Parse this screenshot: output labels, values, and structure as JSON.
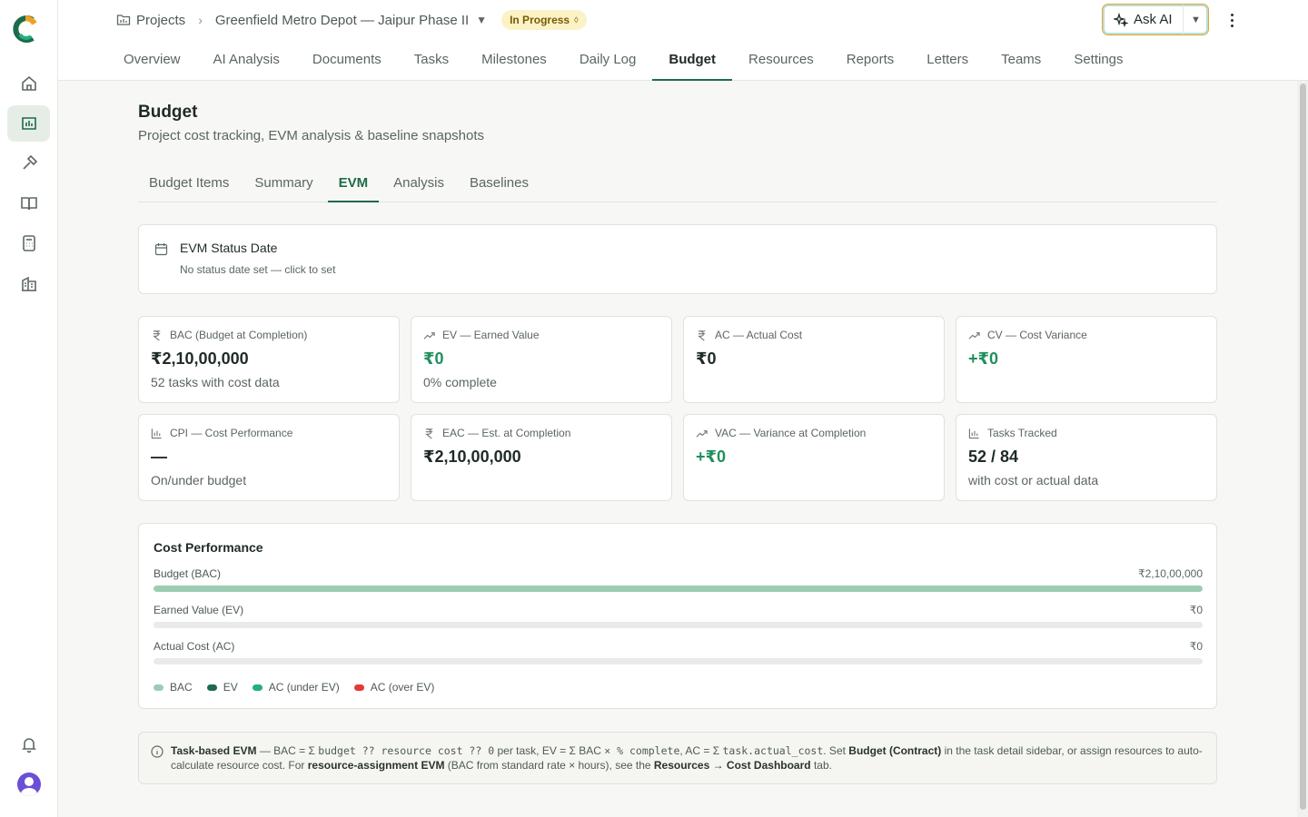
{
  "breadcrumb": {
    "projects": "Projects",
    "separator": "›",
    "project": "Greenfield Metro Depot — Jaipur Phase II",
    "status": "In Progress"
  },
  "header": {
    "ask_ai": "Ask AI",
    "tabs": [
      "Overview",
      "AI Analysis",
      "Documents",
      "Tasks",
      "Milestones",
      "Daily Log",
      "Budget",
      "Resources",
      "Reports",
      "Letters",
      "Teams",
      "Settings"
    ],
    "active_tab": "Budget"
  },
  "page": {
    "title": "Budget",
    "subtitle": "Project cost tracking, EVM analysis & baseline snapshots",
    "subtabs": [
      "Budget Items",
      "Summary",
      "EVM",
      "Analysis",
      "Baselines"
    ],
    "active_subtab": "EVM"
  },
  "status_date": {
    "title": "EVM Status Date",
    "subtitle": "No status date set — click to set"
  },
  "metrics": [
    {
      "icon": "rupee-icon",
      "label": "BAC (Budget at Completion)",
      "value": "₹2,10,00,000",
      "note": "52 tasks with cost data",
      "green": false
    },
    {
      "icon": "trend-up-icon",
      "label": "EV — Earned Value",
      "value": "₹0",
      "note": "0% complete",
      "green": true
    },
    {
      "icon": "rupee-icon",
      "label": "AC — Actual Cost",
      "value": "₹0",
      "note": "",
      "green": false
    },
    {
      "icon": "trend-up-icon",
      "label": "CV — Cost Variance",
      "value": "+₹0",
      "note": "",
      "green": true
    },
    {
      "icon": "bar-chart-icon",
      "label": "CPI — Cost Performance",
      "value": "—",
      "note": "On/under budget",
      "green": false
    },
    {
      "icon": "rupee-icon",
      "label": "EAC — Est. at Completion",
      "value": "₹2,10,00,000",
      "note": "",
      "green": false
    },
    {
      "icon": "trend-up-icon",
      "label": "VAC — Variance at Completion",
      "value": "+₹0",
      "note": "",
      "green": true
    },
    {
      "icon": "bar-chart-icon",
      "label": "Tasks Tracked",
      "value": "52 / 84",
      "note": "with cost or actual data",
      "green": false
    }
  ],
  "cost_performance": {
    "title": "Cost Performance",
    "bars": [
      {
        "label": "Budget (BAC)",
        "value": "₹2,10,00,000",
        "fraction": 1.0,
        "color": "#9ccdb4"
      },
      {
        "label": "Earned Value (EV)",
        "value": "₹0",
        "fraction": 0.0,
        "color": "#1d6b4a"
      },
      {
        "label": "Actual Cost (AC)",
        "value": "₹0",
        "fraction": 0.0,
        "color": "#22b07d"
      }
    ],
    "legend": [
      {
        "label": "BAC",
        "color": "#9ccdb4"
      },
      {
        "label": "EV",
        "color": "#1d6b4a"
      },
      {
        "label": "AC (under EV)",
        "color": "#22b07d"
      },
      {
        "label": "AC (over EV)",
        "color": "#e53935"
      }
    ]
  },
  "info": {
    "p1": "Task-based EVM",
    "p2": " — BAC = Σ ",
    "p3": "budget ?? resource cost ?? 0",
    "p4": " per task, EV = Σ BAC ",
    "p5": "× % complete",
    "p6": ", AC = Σ ",
    "p7": "task.actual_cost",
    "p8": ". Set ",
    "p9": "Budget (Contract)",
    "p10": " in the task detail sidebar, or assign resources to auto-calculate resource cost. For ",
    "p11": "resource-assignment EVM",
    "p12": " (BAC from standard rate × hours), see the ",
    "p13": "Resources → Cost Dashboard",
    "p14": " tab."
  },
  "colors": {
    "accent": "#1d6b4a",
    "status_bg": "#fbf2c6",
    "ask_ai_border": "#e8a436"
  }
}
